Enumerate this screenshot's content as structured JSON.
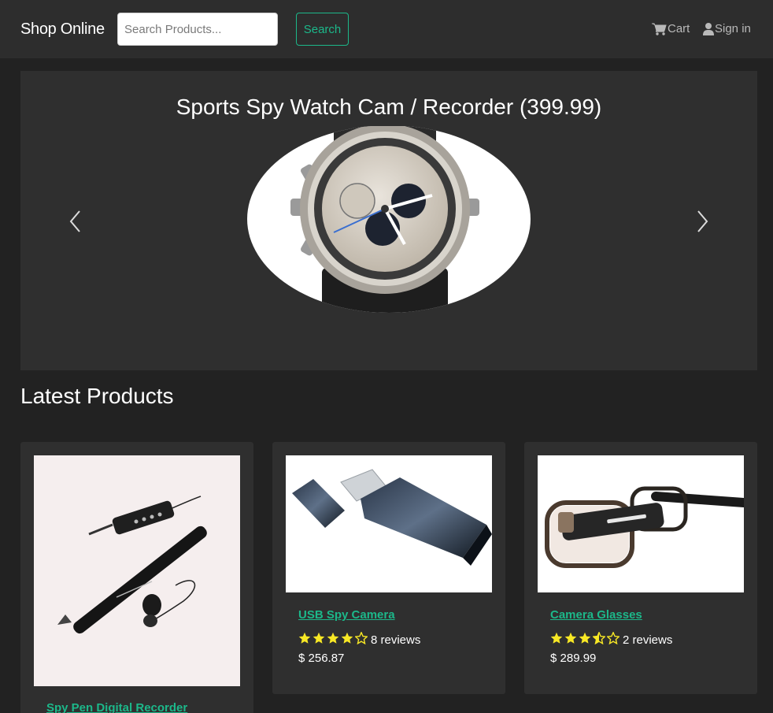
{
  "navbar": {
    "brand": "Shop Online",
    "search_placeholder": "Search Products...",
    "search_button": "Search",
    "cart_label": "Cart",
    "signin_label": "Sign in"
  },
  "carousel": {
    "caption": "Sports Spy Watch Cam / Recorder (399.99)",
    "prev_icon": "chevron-left-icon",
    "next_icon": "chevron-right-icon"
  },
  "latest": {
    "title": "Latest Products",
    "products": [
      {
        "name": "Spy Pen Digital Recorder"
      },
      {
        "name": "USB Spy Camera",
        "rating": 4,
        "reviews_text": "8 reviews",
        "price": "$ 256.87"
      },
      {
        "name": "Camera Glasses",
        "rating": 3.5,
        "reviews_text": "2 reviews",
        "price": "$ 289.99"
      }
    ]
  },
  "colors": {
    "accent": "#1cb88a",
    "star": "#f8e825",
    "background": "#222222",
    "surface": "#2f2f2f"
  }
}
